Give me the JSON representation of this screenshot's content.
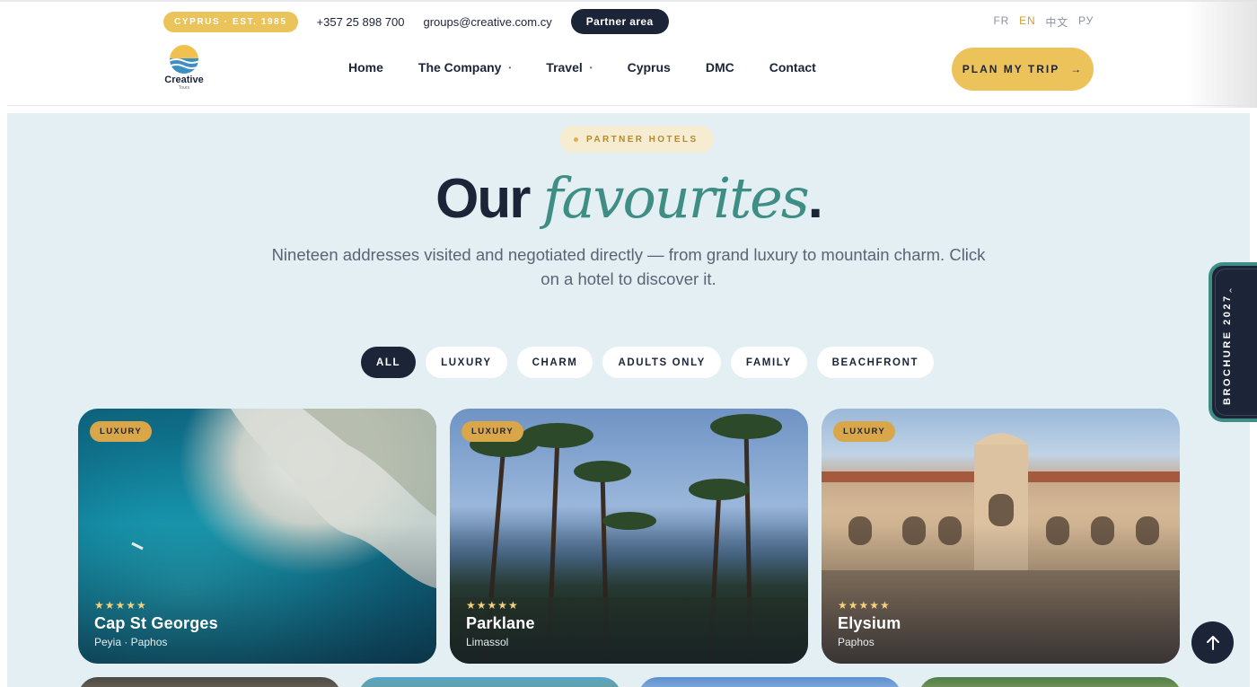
{
  "topbar": {
    "badge": "CYPRUS · EST. 1985",
    "phone": "+357 25 898 700",
    "email": "groups@creative.com.cy",
    "partner_area": "Partner area",
    "languages": [
      "FR",
      "EN",
      "中文",
      "РУ"
    ],
    "active_language": "EN"
  },
  "logo": {
    "name": "Creative",
    "sub": "Tours"
  },
  "nav": {
    "items": [
      {
        "label": "Home",
        "has_dropdown": false
      },
      {
        "label": "The Company",
        "has_dropdown": true
      },
      {
        "label": "Travel",
        "has_dropdown": true
      },
      {
        "label": "Cyprus",
        "has_dropdown": false
      },
      {
        "label": "DMC",
        "has_dropdown": false
      },
      {
        "label": "Contact",
        "has_dropdown": false
      }
    ],
    "cta": "PLAN MY TRIP",
    "cta_icon": "arrow-right-icon"
  },
  "hero": {
    "eyebrow": "PARTNER HOTELS",
    "title_plain": "Our",
    "title_script": "favourites",
    "title_end": ".",
    "subtitle": "Nineteen addresses visited and negotiated directly — from grand luxury to mountain charm. Click on a hotel to discover it."
  },
  "filters": {
    "options": [
      "ALL",
      "LUXURY",
      "CHARM",
      "ADULTS ONLY",
      "FAMILY",
      "BEACHFRONT"
    ],
    "selected": "ALL"
  },
  "hotels": [
    {
      "tag": "LUXURY",
      "stars": "★★★★★",
      "rating": 5,
      "name": "Cap St Georges",
      "location": "Peyia · Paphos"
    },
    {
      "tag": "LUXURY",
      "stars": "★★★★★",
      "rating": 5,
      "name": "Parklane",
      "location": "Limassol"
    },
    {
      "tag": "LUXURY",
      "stars": "★★★★★",
      "rating": 5,
      "name": "Elysium",
      "location": "Paphos"
    }
  ],
  "brochure": {
    "label": "BROCHURE 2027",
    "chevron": "‹"
  },
  "colors": {
    "navy": "#1c2438",
    "gold": "#ecc35a",
    "teal": "#3f8e85",
    "section_bg": "#e3eff3"
  }
}
